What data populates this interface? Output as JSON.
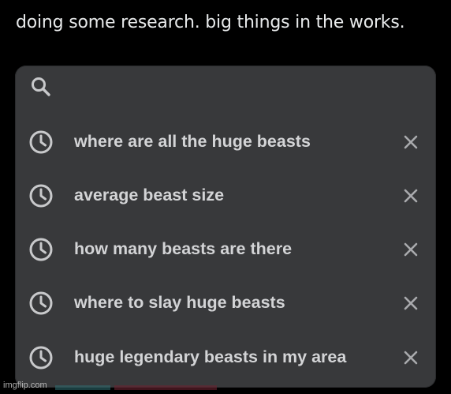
{
  "post": {
    "caption": "doing some research. big things in the works."
  },
  "search": {
    "value": "",
    "icon": "search-icon"
  },
  "history": [
    {
      "label": "where are all the huge beasts",
      "icon": "clock-icon",
      "remove_icon": "close-icon"
    },
    {
      "label": "average beast size",
      "icon": "clock-icon",
      "remove_icon": "close-icon"
    },
    {
      "label": "how many beasts are there",
      "icon": "clock-icon",
      "remove_icon": "close-icon"
    },
    {
      "label": "where to slay huge beasts",
      "icon": "clock-icon",
      "remove_icon": "close-icon"
    },
    {
      "label": "huge legendary beasts in my area",
      "icon": "clock-icon",
      "remove_icon": "close-icon"
    }
  ],
  "watermark": "imgflip.com",
  "colors": {
    "background": "#000000",
    "panel": "#38393b",
    "text": "#d3d4d6",
    "icon": "#c8c9cb",
    "remove": "#a9aaad"
  }
}
